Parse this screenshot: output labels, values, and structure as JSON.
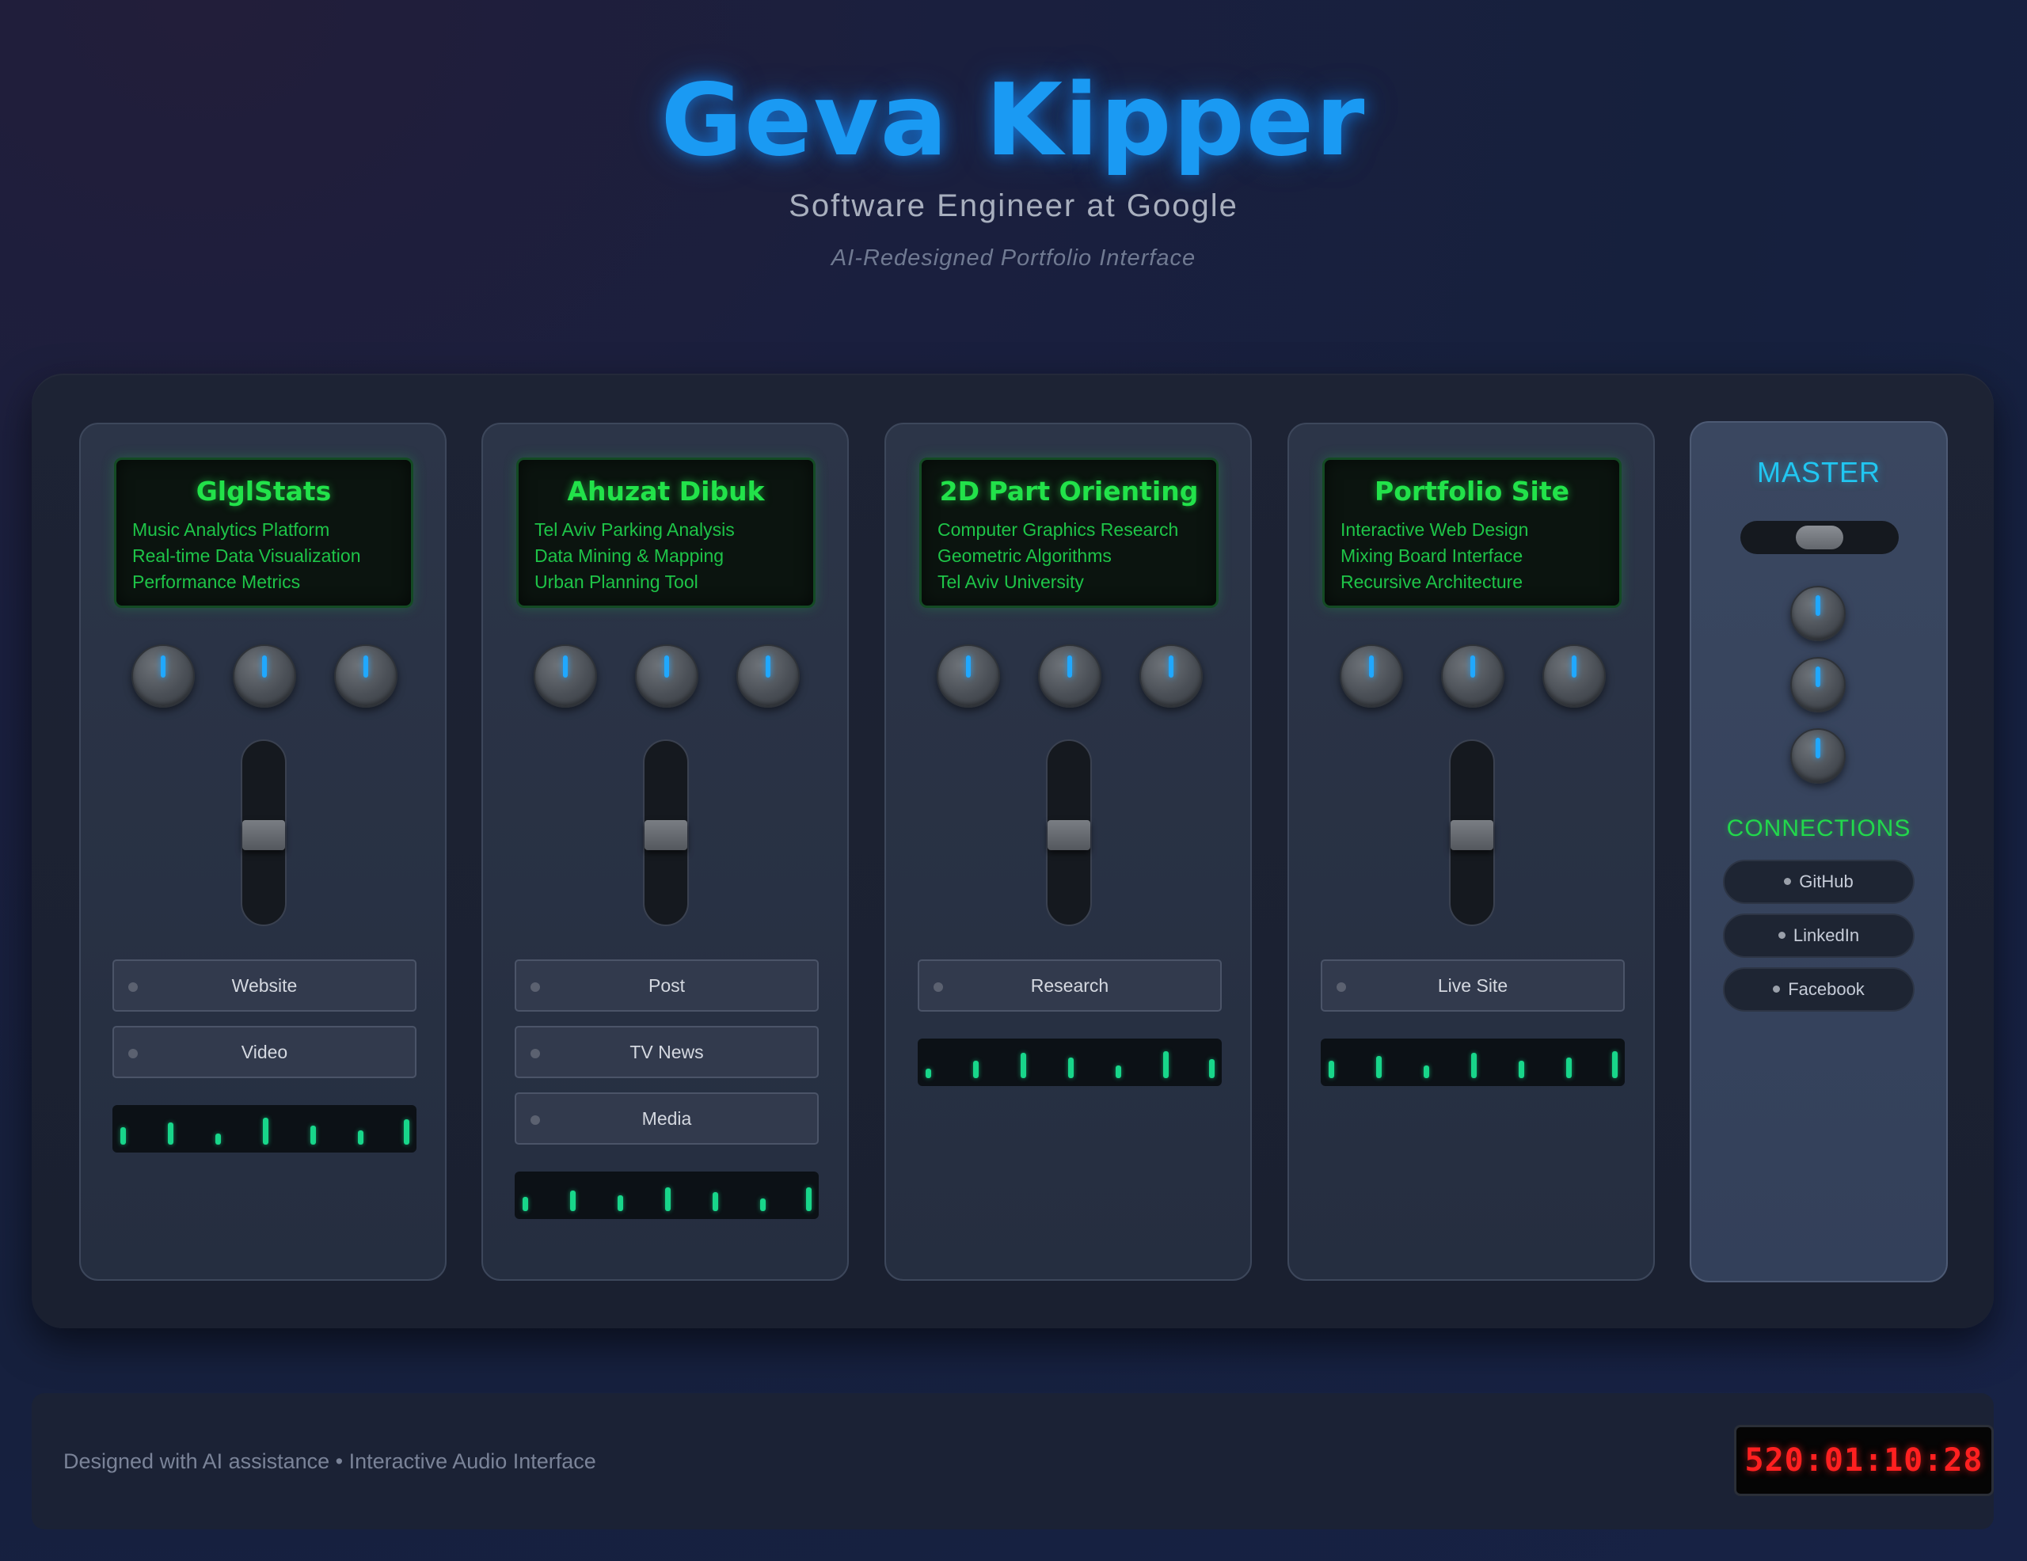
{
  "header": {
    "title": "Geva Kipper",
    "subtitle": "Software Engineer at Google",
    "tagline": "AI-Redesigned Portfolio Interface"
  },
  "channels": [
    {
      "title": "GlglStats",
      "lines": [
        "Music Analytics Platform",
        "Real-time Data Visualization",
        "Performance Metrics"
      ],
      "buttons": [
        "Website",
        "Video"
      ]
    },
    {
      "title": "Ahuzat Dibuk",
      "lines": [
        "Tel Aviv Parking Analysis",
        "Data Mining & Mapping",
        "Urban Planning Tool"
      ],
      "buttons": [
        "Post",
        "TV News",
        "Media"
      ]
    },
    {
      "title": "2D Part Orienting",
      "lines": [
        "Computer Graphics Research",
        "Geometric Algorithms",
        "Tel Aviv University"
      ],
      "buttons": [
        "Research"
      ]
    },
    {
      "title": "Portfolio Site",
      "lines": [
        "Interactive Web Design",
        "Mixing Board Interface",
        "Recursive Architecture"
      ],
      "buttons": [
        "Live Site"
      ]
    }
  ],
  "master": {
    "title": "MASTER",
    "connections_title": "CONNECTIONS",
    "connections": [
      "GitHub",
      "LinkedIn",
      "Facebook"
    ]
  },
  "footer": {
    "text": "Designed with AI assistance • Interactive Audio Interface",
    "clock": "520:01:10:28"
  },
  "colors": {
    "title_blue": "#1a9af3",
    "display_green": "#22e24a",
    "knob_indicator": "#20a8ff",
    "meter_green": "#18d68a",
    "clock_red": "#ff2020",
    "master_cyan": "#21c6f1"
  }
}
